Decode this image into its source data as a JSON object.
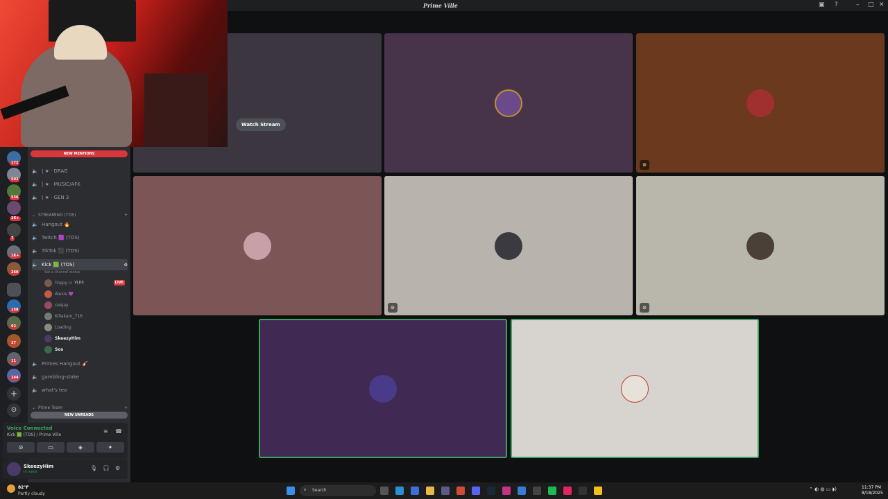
{
  "window": {
    "title": "Prime Ville"
  },
  "server_badges": [
    "172",
    "502",
    "536",
    "2K+",
    "7",
    "1K+",
    "260",
    "158",
    "92",
    "27",
    "11",
    "144"
  ],
  "channels": {
    "new_mentions": "NEW MENTIONS",
    "text_channels": [
      "| ★ · DRAG",
      "| ★ · MUSIC/AFK",
      "| ★ · GEN 3"
    ],
    "category": "STREAMING (TOS)",
    "voice_channels": [
      "Hangout 🔥",
      "Twitch 🟪 (TOS)",
      "TikTok ⬛ (TOS)"
    ],
    "active_channel": "Kick 🟩 (TOS)",
    "channel_status_placeholder": "Set a channel status",
    "members": [
      {
        "name": "Trippy U",
        "tag": "VLDS",
        "live": "LIVE"
      },
      {
        "name": "Alexis 💜"
      },
      {
        "name": "ceejay"
      },
      {
        "name": "Killakam_716"
      },
      {
        "name": "Loading"
      },
      {
        "name": "SkeezyHim"
      },
      {
        "name": "Sos"
      }
    ],
    "more_channels": [
      "Primes Hangout 🎸",
      "gambling-stake",
      "what's tea"
    ],
    "category2": "Prime Team",
    "new_unreads": "NEW UNREADS"
  },
  "voice_panel": {
    "status": "Voice Connected",
    "location": "Kick 🟩 (TOS) / Prime Ville"
  },
  "user_panel": {
    "name": "SkeezyHim",
    "status": "In voice"
  },
  "stage": {
    "watch_stream": "Watch Stream"
  },
  "tile_colors": [
    "#3c3641",
    "#47334a",
    "#6b3a1e",
    "#7c5556",
    "#b8b4ad",
    "#b9b6ac",
    "#402a53",
    "#d7d4cf"
  ],
  "taskbar": {
    "weather_temp": "82°F",
    "weather_desc": "Partly cloudy",
    "search": "Search",
    "time": "11:37 PM",
    "date": "8/18/2025"
  }
}
